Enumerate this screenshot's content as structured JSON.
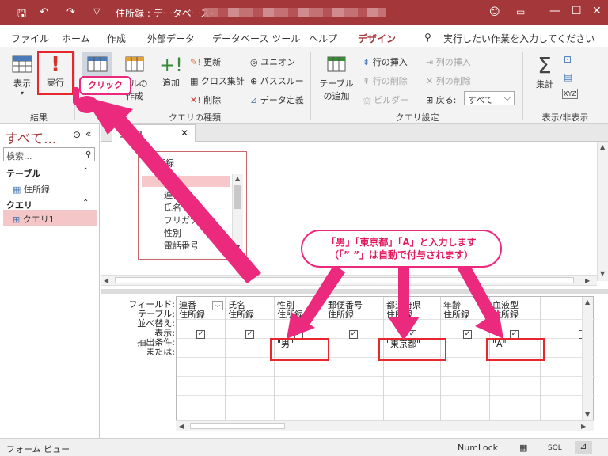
{
  "titlebar": {
    "title": "住所録 : データベース-",
    "save_icon": "save-icon",
    "undo_icon": "undo-icon",
    "redo_icon": "redo-icon",
    "qat_icon": "customize-qat-icon",
    "profile_icon": "profile-icon",
    "ribbon_display_icon": "ribbon-display-icon",
    "minimize": "—",
    "maximize": "☐",
    "close": "✕"
  },
  "menu": {
    "items": [
      "ファイル",
      "ホーム",
      "作成",
      "外部データ",
      "データベース ツール",
      "ヘルプ",
      "デザイン"
    ],
    "search_placeholder": "実行したい作業を入力してください"
  },
  "ribbon": {
    "groups": {
      "results": "結果",
      "query_type": "クエリの種類",
      "query_setup": "クエリ設定",
      "show_hide": "表示/非表示"
    },
    "buttons": {
      "view": "表示",
      "run": "実行",
      "select": "ブルの",
      "select2": "作成",
      "append": "追加",
      "update": "更新",
      "crosstab": "クロス集計",
      "delete": "削除",
      "union": "ユニオン",
      "passthrough": "パススルー",
      "data_definition": "データ定義",
      "add_table": "テーブル",
      "add_table2": "の追加",
      "insert_rows": "行の挿入",
      "delete_rows": "行の削除",
      "builder": "ビルダー",
      "insert_cols": "列の挿入",
      "delete_cols": "列の削除",
      "return_label": "戻る:",
      "return_value": "すべて",
      "totals": "集計"
    },
    "click_callout": "クリック"
  },
  "navpane": {
    "header": "すべて...",
    "search_placeholder": "検索...",
    "sections": [
      {
        "label": "テーブル",
        "items": [
          "住所録"
        ]
      },
      {
        "label": "クエリ",
        "items": [
          "クエリ1"
        ]
      }
    ]
  },
  "document": {
    "tab_label": "エリ1",
    "field_list": {
      "title": "住所録",
      "fields": [
        "*",
        "連番",
        "氏名",
        "フリガナ",
        "性別",
        "電話番号"
      ]
    },
    "grid": {
      "row_labels": [
        "フィールド:",
        "テーブル:",
        "並べ替え:",
        "表示:",
        "抽出条件:",
        "または:"
      ],
      "columns": [
        {
          "field": "連番",
          "table": "住所録",
          "show": true,
          "criteria": ""
        },
        {
          "field": "氏名",
          "table": "住所録",
          "show": true,
          "criteria": ""
        },
        {
          "field": "性別",
          "table": "住所録",
          "show": true,
          "criteria": "\"男\""
        },
        {
          "field": "郵便番号",
          "table": "住所録",
          "show": true,
          "criteria": ""
        },
        {
          "field": "都道府県",
          "table": "住所録",
          "show": true,
          "criteria": "\"東京都\""
        },
        {
          "field": "年齢",
          "table": "住所録",
          "show": true,
          "criteria": ""
        },
        {
          "field": "血液型",
          "table": "住所録",
          "show": true,
          "criteria": "\"A\""
        },
        {
          "field": "",
          "table": "",
          "show": false,
          "criteria": ""
        }
      ]
    }
  },
  "annotation": {
    "line1": "「男」「東京都」「A」と入力します",
    "line2": "（「” ”」は自動で付与されます）",
    "accent_color": "#ec2a7d"
  },
  "statusbar": {
    "left": "フォーム ビュー",
    "numlock": "NumLock",
    "sql": "SQL"
  },
  "colors": {
    "brand": "#a4373a",
    "highlight": "#e8262d"
  }
}
